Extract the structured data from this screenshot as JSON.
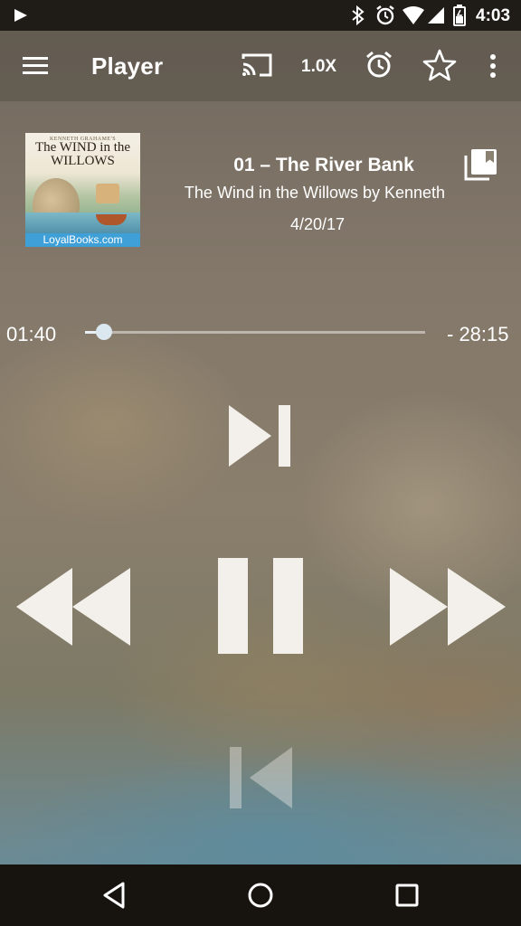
{
  "status_bar": {
    "time": "4:03",
    "icons": [
      "play-icon",
      "bluetooth-icon",
      "alarm-icon",
      "wifi-icon",
      "signal-icon",
      "battery-icon"
    ]
  },
  "toolbar": {
    "title": "Player",
    "speed_label": "1.0X",
    "icons": [
      "menu-icon",
      "cast-icon",
      "sleep-timer-icon",
      "star-icon",
      "more-vert-icon"
    ]
  },
  "track": {
    "title": "01 – The River Bank",
    "book": "The Wind in the Willows by Kenneth",
    "date": "4/20/17",
    "cover": {
      "top_text": "KENNETH GRAHAME'S",
      "title": "The WIND in the WILLOWS",
      "brand": "LoyalBooks.com"
    }
  },
  "progress": {
    "elapsed": "01:40",
    "remaining": "- 28:15",
    "fraction": 0.0559
  },
  "controls": {
    "icons": [
      "skip-next-icon",
      "rewind-icon",
      "pause-icon",
      "fast-forward-icon",
      "skip-previous-icon"
    ]
  },
  "nav_bar": {
    "icons": [
      "back-icon",
      "home-icon",
      "recents-icon"
    ]
  },
  "colors": {
    "status_bar": "#1f1b16",
    "nav_bar": "#17130f",
    "control_fill": "#f3efea",
    "seek_thumb": "#dbe8f0"
  }
}
